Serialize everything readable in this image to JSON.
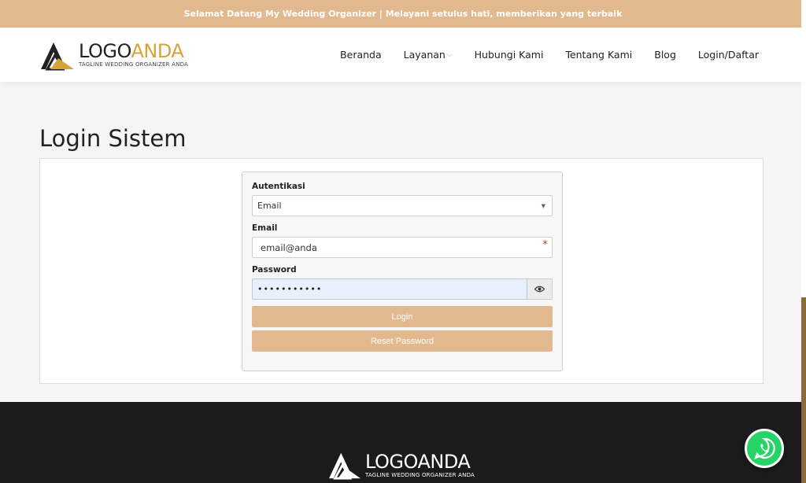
{
  "topbar": {
    "text": "Selamat Datang My Wedding Organizer | Melayani setulus hati, memberikan yang terbaik"
  },
  "brand": {
    "word_a": "LOGO",
    "word_b": "ANDA",
    "tagline": "TAGLINE WEDDING ORGANIZER ANDA",
    "accent": "#d6a33a",
    "theme": "#e2b98e"
  },
  "nav": {
    "items": [
      {
        "label": "Beranda"
      },
      {
        "label": "Layanan"
      },
      {
        "label": "Hubungi Kami"
      },
      {
        "label": "Tentang Kami"
      },
      {
        "label": "Blog"
      },
      {
        "label": "Login/Daftar"
      }
    ],
    "chevron": "chevron-down-icon"
  },
  "page": {
    "title": "Login Sistem"
  },
  "form": {
    "auth_label": "Autentikasi",
    "auth_value": "Email",
    "email_label": "Email",
    "email_value": "email@anda",
    "password_label": "Password",
    "password_value": "•••••••••••",
    "login_label": "Login",
    "reset_label": "Reset Password"
  },
  "footer": {
    "word_a": "LOGO",
    "word_b": "ANDA",
    "tagline": "TAGLINE WEDDING ORGANIZER ANDA"
  },
  "widgets": {
    "whatsapp_icon": "whatsapp-icon"
  }
}
